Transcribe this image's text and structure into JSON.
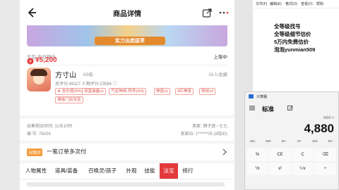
{
  "app": {
    "title": "商品详情",
    "banner_text": "实力出类拔萃",
    "server": "五区-生日快乐",
    "status": "上架中",
    "price": "¥5,200",
    "role": {
      "name": "方寸山",
      "level": "69级",
      "favorites": "26人收藏",
      "score_line": "总评分:49117   人物评分:23584 ⓘ",
      "tags": [
        "★ 全价值30%",
        "双蓝装备x1",
        "气定神闲·符件(4/4)",
        "神兽x1",
        "9红神宠",
        "特技x2",
        "满级门派法宝"
      ]
    },
    "listing": {
      "time_left": "出售剩余时间: 11天10时",
      "item_id": "编 号: 76024",
      "seller": "卖家: 狮子座♂七七",
      "seller_id": "卖家ID: 1******05 (9段ID)"
    },
    "installment": {
      "badge": "分期付",
      "text": "一笔订单多次付"
    },
    "tabs": [
      "人物属性",
      "道具/装备",
      "召唤灵/孩子",
      "外观",
      "技能",
      "法宝",
      "修行"
    ],
    "active_tab": "法宝"
  },
  "notepad": {
    "menu": [
      "文件(F)",
      "编辑(E)",
      "格式(O)",
      "查看(V)",
      "帮助"
    ],
    "lines": [
      "全等级找号",
      "全等级细节估价",
      "5万内免费估价",
      "泡泡yunmian509"
    ]
  },
  "calculator": {
    "title": "计算器",
    "mode": "标准",
    "expression": "4880 =",
    "display": "4,880",
    "memory": [
      "MC",
      "MR",
      "M+",
      "M-",
      "MS",
      "M˅"
    ],
    "keys": [
      "%",
      "CE",
      "C",
      "⌫",
      "⅟x",
      "x²",
      "²√x",
      "÷"
    ]
  },
  "icons": {
    "back": "back-arrow-icon",
    "share": "share-icon",
    "more": "more-icon",
    "chevron": "chevron-right-icon"
  },
  "colors": {
    "accent": "#e4393c",
    "installment": "#f39c3c"
  }
}
